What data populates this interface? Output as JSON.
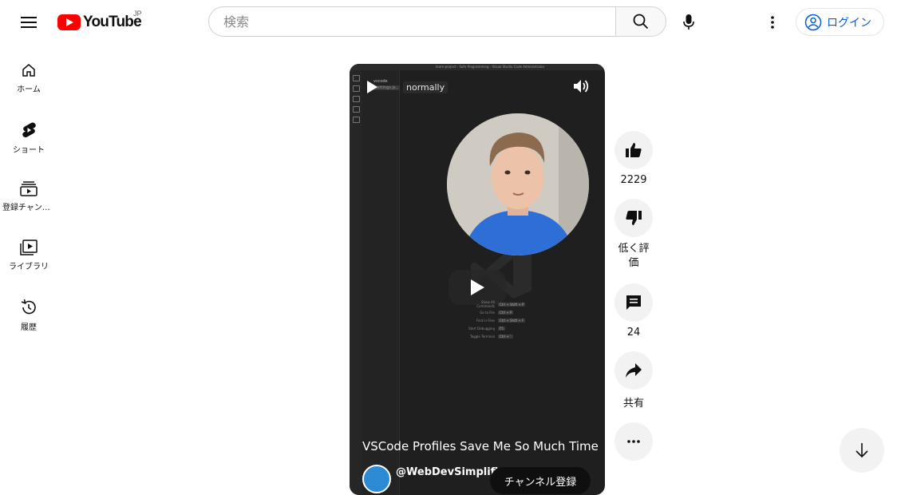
{
  "app": {
    "logo_text": "YouTube",
    "region": "JP"
  },
  "search": {
    "placeholder": "検索",
    "value": ""
  },
  "header": {
    "login_label": "ログイン"
  },
  "sidebar": {
    "items": [
      {
        "label": "ホーム",
        "icon": "home-icon"
      },
      {
        "label": "ショート",
        "icon": "shorts-icon"
      },
      {
        "label": "登録チャンネル",
        "icon": "subscriptions-icon"
      },
      {
        "label": "ライブラリ",
        "icon": "library-icon"
      },
      {
        "label": "履歴",
        "icon": "history-icon"
      }
    ]
  },
  "player": {
    "playback_label": "normally",
    "video_title": "VSCode Profiles Save Me So Much Time",
    "channel_name": "@WebDevSimplifi",
    "subscribe_label": "チャンネル登録",
    "editor_title": "learn-project - Safe Programming - Visual Studio Code Administrator",
    "explorer_header": "vscode",
    "explorer_file": "settings.js..",
    "shortcuts": [
      {
        "name": "Show All Commands",
        "keys": "Ctrl + Shift + P"
      },
      {
        "name": "Go to File",
        "keys": "Ctrl + P"
      },
      {
        "name": "Find in Files",
        "keys": "Ctrl + Shift + F"
      },
      {
        "name": "Start Debugging",
        "keys": "F5"
      },
      {
        "name": "Toggle Terminal",
        "keys": "Ctrl + `"
      }
    ]
  },
  "actions": {
    "like_count": "2229",
    "dislike_label": "低く評価",
    "comment_count": "24",
    "share_label": "共有"
  },
  "colors": {
    "brand_red": "#ff0000",
    "link_blue": "#065fd4",
    "button_gray": "#f2f2f2"
  }
}
